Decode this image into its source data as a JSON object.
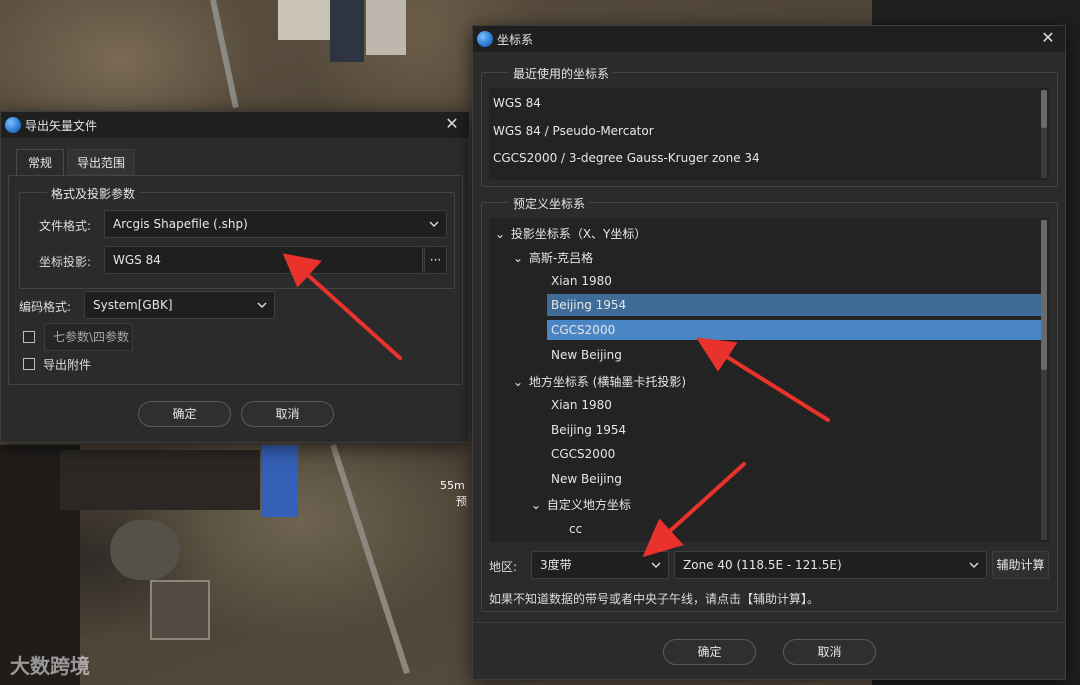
{
  "colors": {
    "accent_selected": "#4a86c5",
    "hover_selected": "#3f6c97",
    "arrow": "#e8322b"
  },
  "map_labels": [
    "55m",
    "预"
  ],
  "watermark": "大数跨境",
  "export_dialog": {
    "title": "导出矢量文件",
    "tabs": [
      "常规",
      "导出范围"
    ],
    "group_title": "格式及投影参数",
    "file_format_label": "文件格式:",
    "file_format_value": "Arcgis Shapefile (.shp)",
    "projection_label": "坐标投影:",
    "projection_value": "WGS 84",
    "browse_label": "···",
    "encoding_label": "编码格式:",
    "encoding_value": "System[GBK]",
    "seven_param_label": "七参数\\四参数",
    "export_attachment_label": "导出附件",
    "ok": "确定",
    "cancel": "取消"
  },
  "crs_dialog": {
    "title": "坐标系",
    "recent_title": "最近使用的坐标系",
    "recent_items": [
      "WGS 84",
      "WGS 84 / Pseudo-Mercator",
      "CGCS2000 / 3-degree Gauss-Kruger zone 34"
    ],
    "predefined_title": "预定义坐标系",
    "tree": {
      "projected": "投影坐标系（X、Y坐标）",
      "gauss": "高斯-克吕格",
      "gauss_items": [
        "Xian 1980",
        "Beijing 1954",
        "CGCS2000",
        "New Beijing"
      ],
      "local": "地方坐标系 (横轴墨卡托投影)",
      "local_items": [
        "Xian 1980",
        "Beijing 1954",
        "CGCS2000",
        "New Beijing"
      ],
      "custom": "自定义地方坐标",
      "custom_items": [
        "cc"
      ]
    },
    "region_label": "地区:",
    "region_value": "3度带",
    "zone_value": "Zone 40 (118.5E - 121.5E)",
    "calc_button": "辅助计算",
    "hint": "如果不知道数据的带号或者中央子午线，请点击【辅助计算】。",
    "ok": "确定",
    "cancel": "取消"
  }
}
